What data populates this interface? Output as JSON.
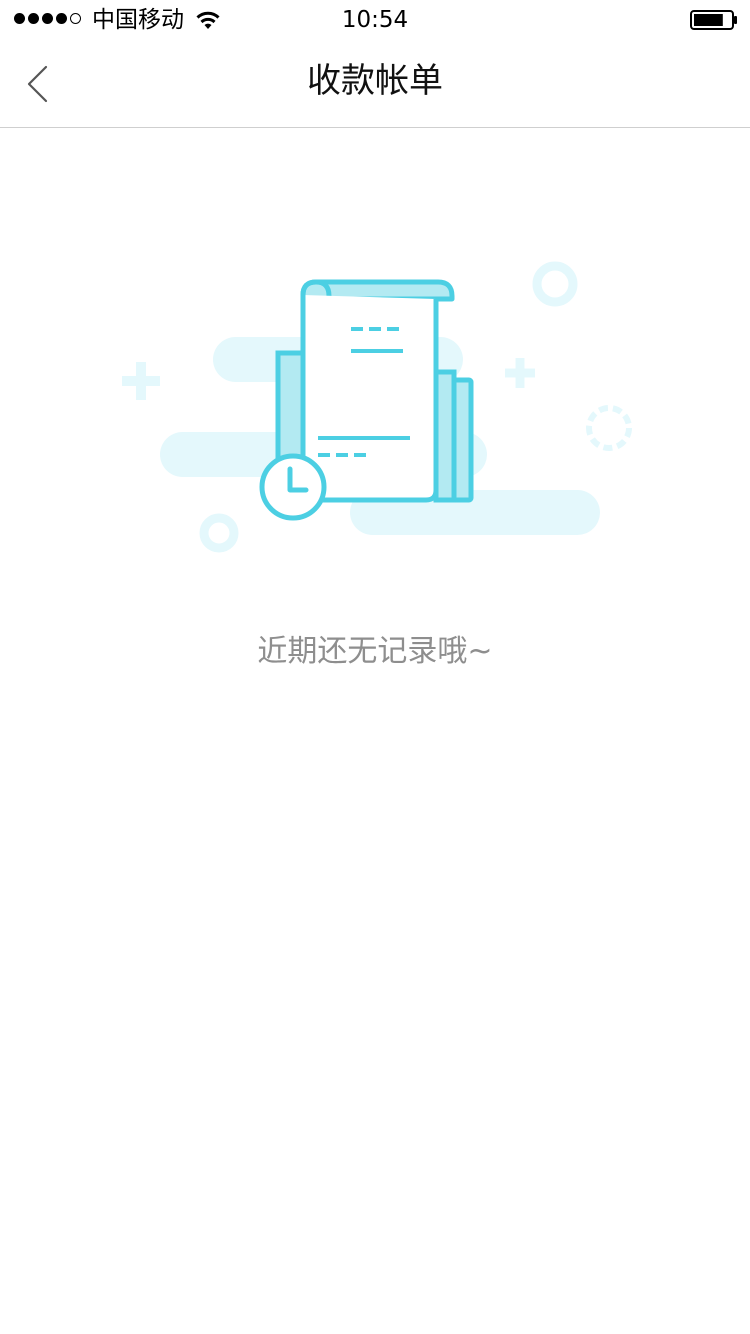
{
  "status_bar": {
    "carrier": "中国移动",
    "time": "10:54",
    "signal_bars_filled": 4,
    "signal_bars_total": 5,
    "battery_level": 0.8
  },
  "nav": {
    "title": "收款帐单",
    "back_icon": "chevron-left-icon"
  },
  "empty_state": {
    "message": "近期还无记录哦~",
    "illustration_icon": "receipt-clock-icon"
  },
  "colors": {
    "accent": "#4ccfe3",
    "accent_light": "#b3eaf2",
    "decor": "#e4f8fc",
    "divider": "#cfcfcf",
    "muted_text": "#8e8e8e"
  }
}
